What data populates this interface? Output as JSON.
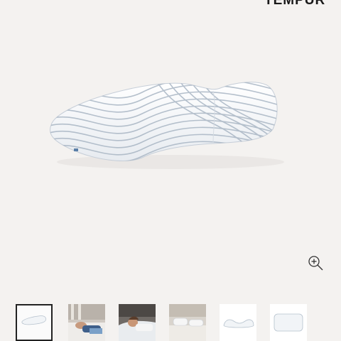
{
  "header": {
    "brand": "TEMPUR"
  },
  "gallery": {
    "main_image": "contour-pillow-product-image",
    "zoom_icon": "zoom-in-icon",
    "thumbnails": [
      {
        "icon": "pillow-product-thumbnail",
        "selected": true
      },
      {
        "icon": "pillow-lifestyle-sleeper-thumbnail",
        "selected": false
      },
      {
        "icon": "pillow-side-sleeper-thumbnail",
        "selected": false
      },
      {
        "icon": "pillow-bed-scene-thumbnail",
        "selected": false
      },
      {
        "icon": "pillow-side-view-thumbnail",
        "selected": false
      },
      {
        "icon": "pillow-top-view-thumbnail",
        "selected": false
      }
    ]
  },
  "colors": {
    "background": "#f4f2f0",
    "pillow": "#f3f5f8",
    "pattern": "#a9b6c4",
    "active_border": "#222222"
  }
}
